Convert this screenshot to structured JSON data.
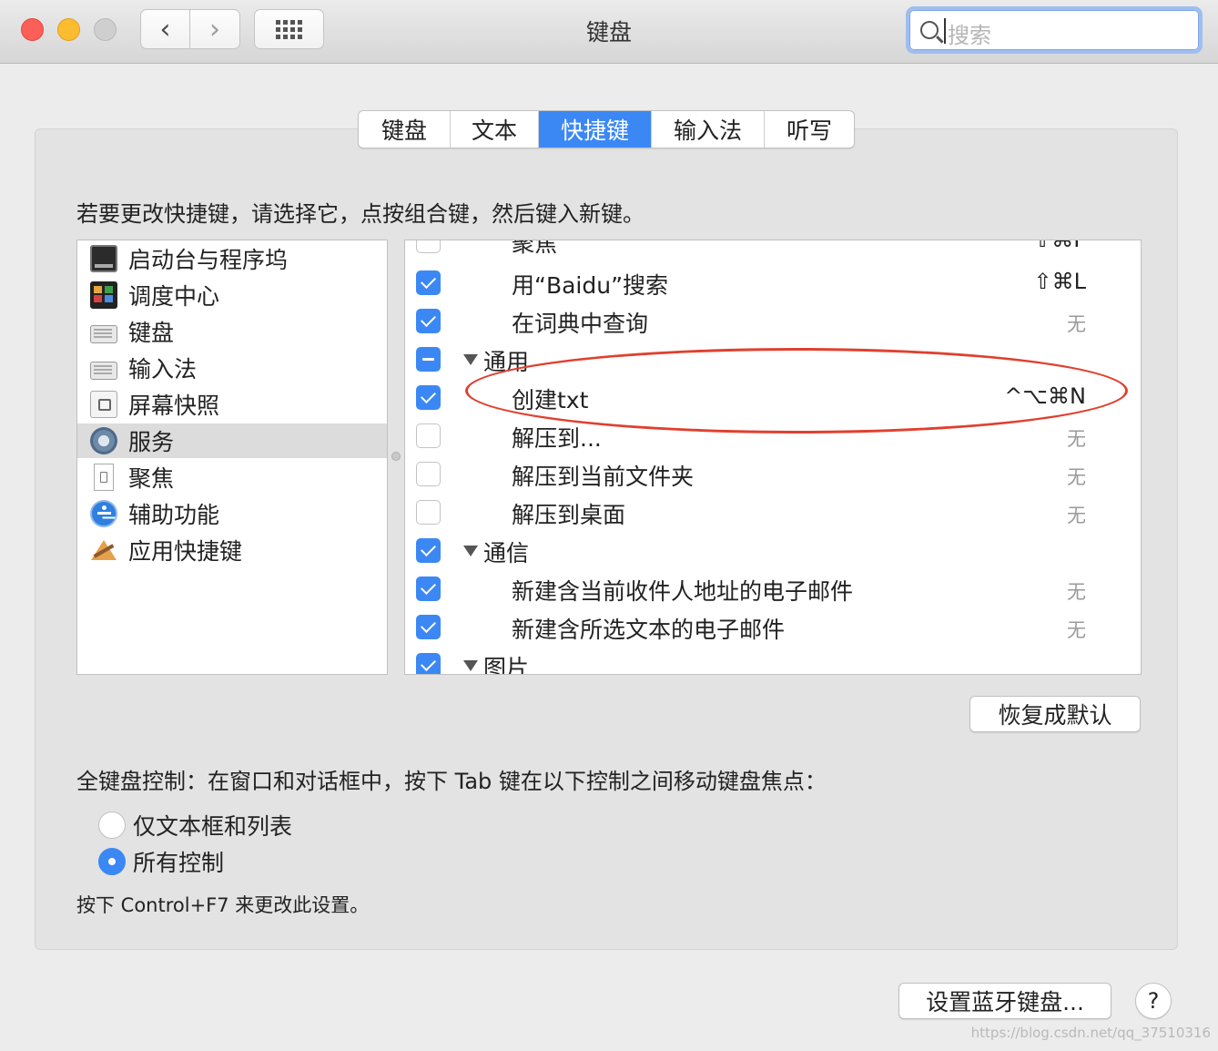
{
  "window": {
    "title": "键盘",
    "search_placeholder": "搜索"
  },
  "tabs": [
    {
      "label": "键盘",
      "active": false
    },
    {
      "label": "文本",
      "active": false
    },
    {
      "label": "快捷键",
      "active": true
    },
    {
      "label": "输入法",
      "active": false
    },
    {
      "label": "听写",
      "active": false
    }
  ],
  "instruction": "若要更改快捷键，请选择它，点按组合键，然后键入新键。",
  "categories": [
    {
      "label": "启动台与程序坞",
      "icon": "launchpad-dock-icon",
      "selected": false
    },
    {
      "label": "调度中心",
      "icon": "mission-control-icon",
      "selected": false
    },
    {
      "label": "键盘",
      "icon": "keyboard-icon",
      "selected": false
    },
    {
      "label": "输入法",
      "icon": "input-method-icon",
      "selected": false
    },
    {
      "label": "屏幕快照",
      "icon": "screenshot-icon",
      "selected": false
    },
    {
      "label": "服务",
      "icon": "gear-icon",
      "selected": true
    },
    {
      "label": "聚焦",
      "icon": "spotlight-document-icon",
      "selected": false
    },
    {
      "label": "辅助功能",
      "icon": "accessibility-icon",
      "selected": false
    },
    {
      "label": "应用快捷键",
      "icon": "app-shortcuts-icon",
      "selected": false
    }
  ],
  "shortcuts": [
    {
      "label": "聚焦",
      "key": "⇧⌘F",
      "state": "off",
      "type": "item"
    },
    {
      "label": "用“Baidu”搜索",
      "key": "⇧⌘L",
      "state": "on",
      "type": "item"
    },
    {
      "label": "在词典中查询",
      "key": "无",
      "state": "on",
      "type": "item"
    },
    {
      "label": "通用",
      "key": "",
      "state": "mixed",
      "type": "group"
    },
    {
      "label": "创建txt",
      "key": "^⌥⌘N",
      "state": "on",
      "type": "item"
    },
    {
      "label": "解压到...",
      "key": "无",
      "state": "off",
      "type": "item"
    },
    {
      "label": "解压到当前文件夹",
      "key": "无",
      "state": "off",
      "type": "item"
    },
    {
      "label": "解压到桌面",
      "key": "无",
      "state": "off",
      "type": "item"
    },
    {
      "label": "通信",
      "key": "",
      "state": "on",
      "type": "group"
    },
    {
      "label": "新建含当前收件人地址的电子邮件",
      "key": "无",
      "state": "on",
      "type": "item"
    },
    {
      "label": "新建含所选文本的电子邮件",
      "key": "无",
      "state": "on",
      "type": "item"
    },
    {
      "label": "图片",
      "key": "",
      "state": "on",
      "type": "group"
    }
  ],
  "restore_button": "恢复成默认",
  "full_keyboard": {
    "description": "全键盘控制：在窗口和对话框中，按下 Tab 键在以下控制之间移动键盘焦点：",
    "options": [
      {
        "label": "仅文本框和列表",
        "selected": false
      },
      {
        "label": "所有控制",
        "selected": true
      }
    ],
    "hint": "按下 Control+F7 来更改此设置。"
  },
  "bluetooth_button": "设置蓝牙键盘...",
  "help_button": "?",
  "watermark": "https://blog.csdn.net/qq_37510316",
  "colors": {
    "accent": "#3b88f5",
    "highlight_oval": "#e0402e"
  }
}
